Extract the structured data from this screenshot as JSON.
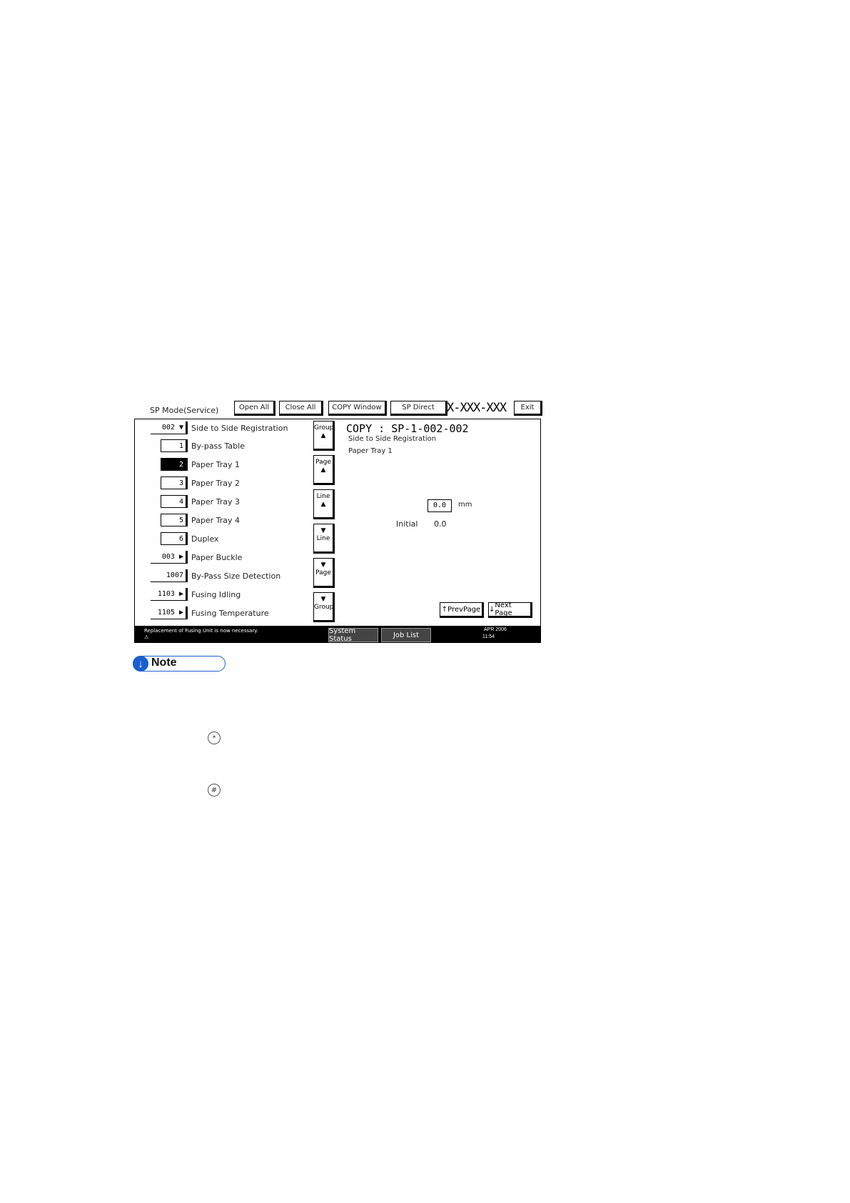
{
  "topbar": {
    "title": "SP Mode(Service)",
    "buttons": [
      "Open All",
      "Close All",
      "COPY Window",
      "SP Direct"
    ],
    "model": "X-XXX-XXX",
    "exit": "Exit"
  },
  "list": {
    "rows": [
      {
        "num": "002 ▼",
        "label": "Side to Side Registration"
      },
      {
        "num": "1",
        "label": "By-pass Table"
      },
      {
        "num": "2",
        "label": "Paper Tray 1"
      },
      {
        "num": "3",
        "label": "Paper Tray 2"
      },
      {
        "num": "4",
        "label": "Paper Tray 3"
      },
      {
        "num": "5",
        "label": "Paper Tray 4"
      },
      {
        "num": "6",
        "label": "Duplex"
      },
      {
        "num": "003 ▶",
        "label": "Paper Buckle"
      },
      {
        "num": "1007",
        "label": "By-Pass Size Detection"
      },
      {
        "num": "1103 ▶",
        "label": "Fusing Idling"
      },
      {
        "num": "1105 ▶",
        "label": "Fusing Temperature"
      }
    ]
  },
  "scroll": {
    "group_up": "Group",
    "page_up": "Page",
    "line_up": "Line",
    "line_down": "Line",
    "page_down": "Page",
    "group_down": "Group"
  },
  "detail": {
    "title": "COPY : SP-1-002-002",
    "line1": "Side to Side Registration",
    "line2": "Paper Tray 1",
    "value": "0.0",
    "unit": "mm",
    "initial_label": "Initial",
    "initial_value": "0.0",
    "prev_page": "PrevPage",
    "next_page": "Next Page"
  },
  "status": {
    "message": "Replacement of Fusing Unit is now necessary.",
    "system_status": "System Status",
    "job_list": "Job List",
    "date": "APR 2006",
    "time": "11:54"
  },
  "note": {
    "label": "Note"
  },
  "keys": {
    "key1": "*",
    "key2": "#"
  }
}
